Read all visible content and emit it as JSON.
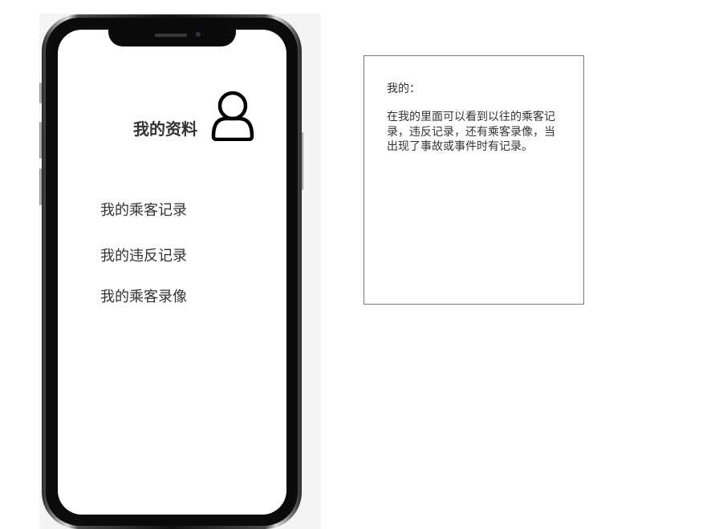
{
  "phone": {
    "profile_title": "我的资料",
    "profile_icon": "user-icon",
    "menu": [
      {
        "label": "我的乘客记录"
      },
      {
        "label": "我的违反记录"
      },
      {
        "label": "我的乘客录像"
      }
    ]
  },
  "note": {
    "title": "我的：",
    "body": "在我的里面可以看到以往的乘客记录，违反记录，还有乘客录像，当出现了事故或事件时有记录。"
  },
  "colors": {
    "text": "#333333",
    "note_border": "#7a7a7a",
    "phone_bezel": "#0b0b0b"
  }
}
